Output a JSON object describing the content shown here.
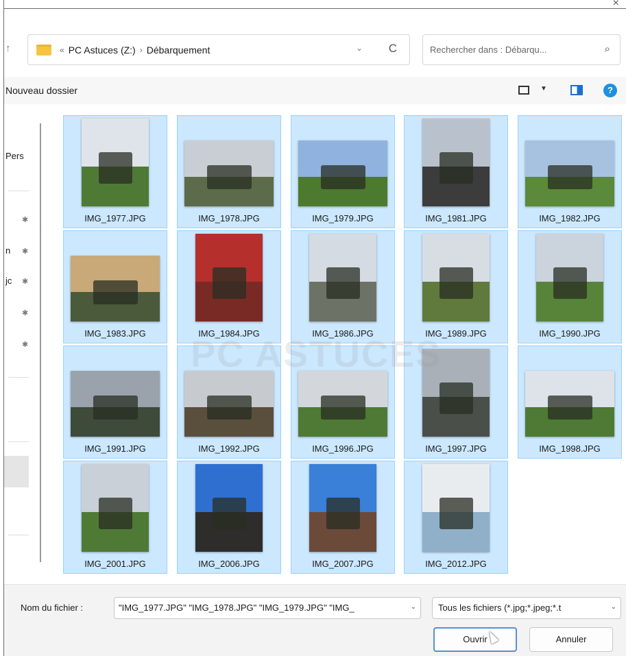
{
  "address": {
    "prefix": "«",
    "drive": "PC Astuces (Z:)",
    "separator": "›",
    "folder": "Débarquement"
  },
  "search": {
    "placeholder": "Rechercher dans : Débarqu..."
  },
  "toolbar": {
    "new_folder": "Nouveau dossier"
  },
  "sidebar": {
    "items": [
      {
        "label": "Pers"
      },
      {
        "label": "n"
      },
      {
        "label": "jc"
      }
    ]
  },
  "files": [
    {
      "name": "IMG_1977.JPG",
      "orient": "portrait",
      "sky": "#dfe4ea",
      "ground": "#4f7a35"
    },
    {
      "name": "IMG_1978.JPG",
      "orient": "landscape",
      "sky": "#c9ced4",
      "ground": "#5c6b4a"
    },
    {
      "name": "IMG_1979.JPG",
      "orient": "landscape",
      "sky": "#8fb3de",
      "ground": "#4c7a2e"
    },
    {
      "name": "IMG_1981.JPG",
      "orient": "portrait",
      "sky": "#b9c2cc",
      "ground": "#3c3c3c"
    },
    {
      "name": "IMG_1982.JPG",
      "orient": "landscape",
      "sky": "#a7c2e0",
      "ground": "#5b8a3a"
    },
    {
      "name": "IMG_1983.JPG",
      "orient": "landscape",
      "sky": "#c9a978",
      "ground": "#4a5a3a"
    },
    {
      "name": "IMG_1984.JPG",
      "orient": "portrait",
      "sky": "#b5302c",
      "ground": "#7a2a24"
    },
    {
      "name": "IMG_1986.JPG",
      "orient": "portrait",
      "sky": "#d5dbe2",
      "ground": "#6d7266"
    },
    {
      "name": "IMG_1989.JPG",
      "orient": "portrait",
      "sky": "#d8dde3",
      "ground": "#5f7a3c"
    },
    {
      "name": "IMG_1990.JPG",
      "orient": "portrait",
      "sky": "#cbd3dc",
      "ground": "#58843a"
    },
    {
      "name": "IMG_1991.JPG",
      "orient": "landscape",
      "sky": "#9aa3ac",
      "ground": "#3e4a3a"
    },
    {
      "name": "IMG_1992.JPG",
      "orient": "landscape",
      "sky": "#c7cbd0",
      "ground": "#5a4e3c"
    },
    {
      "name": "IMG_1996.JPG",
      "orient": "landscape",
      "sky": "#d3d7dc",
      "ground": "#4f7a35"
    },
    {
      "name": "IMG_1997.JPG",
      "orient": "portrait",
      "sky": "#a9b0b8",
      "ground": "#4b4f4a"
    },
    {
      "name": "IMG_1998.JPG",
      "orient": "landscape",
      "sky": "#dde3e9",
      "ground": "#4f7a35"
    },
    {
      "name": "IMG_2001.JPG",
      "orient": "portrait",
      "sky": "#c9d0d8",
      "ground": "#4f7a35"
    },
    {
      "name": "IMG_2006.JPG",
      "orient": "portrait",
      "sky": "#2f6fcf",
      "ground": "#2e2d2b"
    },
    {
      "name": "IMG_2007.JPG",
      "orient": "portrait",
      "sky": "#3a7fd8",
      "ground": "#6b4a3a"
    },
    {
      "name": "IMG_2012.JPG",
      "orient": "portrait",
      "sky": "#e9ecef",
      "ground": "#8fb0c8"
    }
  ],
  "watermark": "PC ASTUCES",
  "bottom": {
    "filename_label": "Nom du fichier :",
    "filename_value": "\"IMG_1977.JPG\" \"IMG_1978.JPG\" \"IMG_1979.JPG\" \"IMG_",
    "filetype_value": "Tous les fichiers (*.jpg;*.jpeg;*.t",
    "open_label": "Ouvrir",
    "cancel_label": "Annuler"
  },
  "icons": {
    "close": "×",
    "up": "↑",
    "chevron": "⌄",
    "refresh": "C",
    "search": "⌕",
    "pin": "✱",
    "help": "?"
  }
}
